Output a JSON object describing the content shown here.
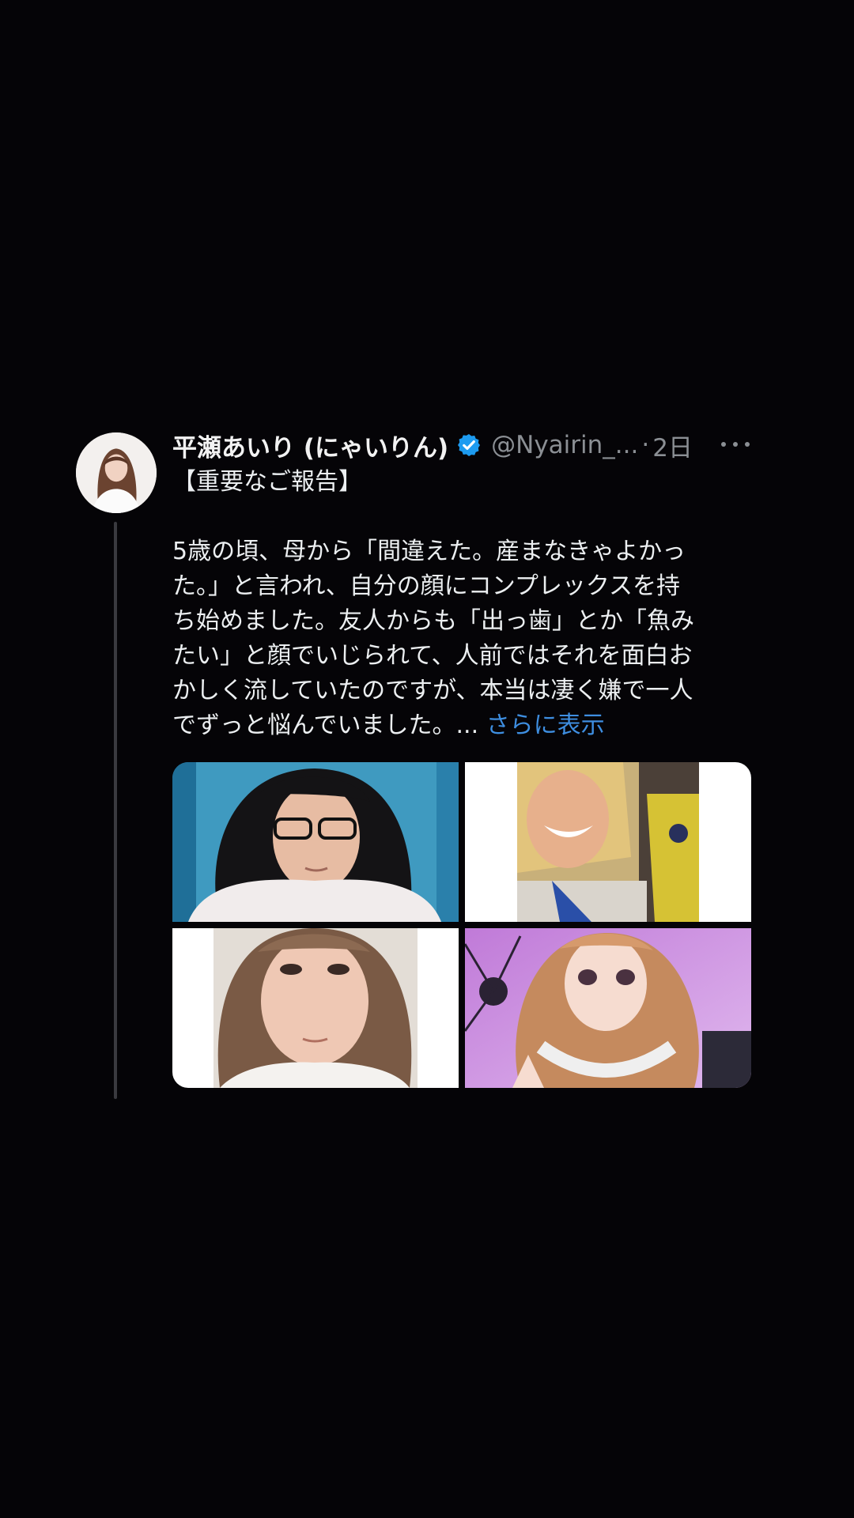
{
  "tweet": {
    "display_name": "平瀬あいり (にゃいりん)",
    "handle": "@Nyairin_...",
    "separator": "·",
    "time": "2日",
    "title": "【重要なご報告】",
    "body_lines": [
      "5歳の頃、母から「間違えた。産まなきゃよかっ",
      "た。」と言われ、自分の顔にコンプレックスを持",
      "ち始めました。友人からも「出っ歯」とか「魚み",
      "たい」と顔でいじられて、人前ではそれを面白お",
      "かしく流していたのですが、本当は凄く嫌で一人"
    ],
    "last_line": "でずっと悩んでいました。... ",
    "show_more": "さらに表示"
  },
  "colors": {
    "background": "#050407",
    "text": "#eceff1",
    "secondary": "#8b8f94",
    "link": "#3e8ee0",
    "verified": "#1d9bf0"
  },
  "icons": {
    "verified": "verified-badge-icon",
    "more": "more-horizontal-icon"
  },
  "media_count": 4
}
